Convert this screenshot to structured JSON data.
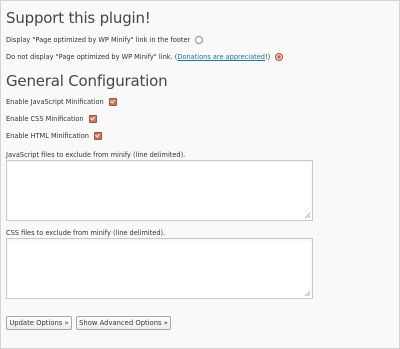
{
  "support": {
    "heading": "Support this plugin!",
    "option_show_link": "Display \"Page optimized by WP Minify\" link in the footer",
    "option_hide_link_prefix": "Do not display \"Page optimized by WP Minify\" link. (",
    "option_hide_link_link": "Donations are appreciated",
    "option_hide_link_suffix": "!)",
    "selected": "hide_link"
  },
  "general": {
    "heading": "General Configuration",
    "js_label": "Enable JavaScript Minification",
    "css_label": "Enable CSS Minification",
    "html_label": "Enable HTML Minification",
    "js_checked": true,
    "css_checked": true,
    "html_checked": true,
    "js_exclude_label": "JavaScript files to exclude from minify (line delimited).",
    "css_exclude_label": "CSS files to exclude from minify (line delimited).",
    "js_exclude_value": "",
    "css_exclude_value": ""
  },
  "buttons": {
    "update": "Update Options »",
    "advanced": "Show Advanced Options »"
  },
  "colors": {
    "link": "#21759b",
    "checkbox_checked": "#d4735a",
    "heading": "#464646"
  }
}
